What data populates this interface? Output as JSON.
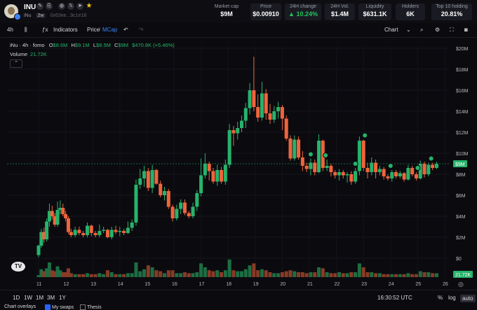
{
  "token": {
    "symbol": "INU",
    "name": "iNu",
    "timeframe_badge": "2w",
    "address": "0x63ee...9c1e18",
    "social_icons": [
      "globe-icon",
      "x-icon",
      "telegram-icon",
      "star-icon"
    ]
  },
  "stats": [
    {
      "label": "Market cap",
      "value": "$9M",
      "boxed": false
    },
    {
      "label": "Price",
      "value": "$0.00910",
      "boxed": true
    },
    {
      "label": "24H change",
      "value": "▲ 10.24%",
      "boxed": true,
      "color": "#22c55e"
    },
    {
      "label": "24H Vol.",
      "value": "$1.4M",
      "boxed": true
    },
    {
      "label": "Liquidity",
      "value": "$631.1K",
      "boxed": true
    },
    {
      "label": "Holders",
      "value": "6K",
      "boxed": true
    },
    {
      "label": "Top 10 holding",
      "value": "20.81%",
      "boxed": true
    }
  ],
  "toolbar": {
    "interval": "4h",
    "indicators": "Indicators",
    "price": "Price",
    "mcap": "MCap",
    "chart": "Chart"
  },
  "legend": {
    "title": "iNu · 4h · fomo",
    "o": "$8.6M",
    "h": "$9.1M",
    "l": "$8.5M",
    "c": "$9M",
    "change": "$470.8K (+5.46%)",
    "volume_label": "Volume",
    "volume_value": "21.72K"
  },
  "chart_data": {
    "type": "candlestick",
    "y_ticks": [
      "$0",
      "$2M",
      "$4M",
      "$6M",
      "$8M",
      "$10M",
      "$12M",
      "$14M",
      "$16M",
      "$18M",
      "$20M"
    ],
    "x_ticks": [
      "11",
      "12",
      "13",
      "14",
      "15",
      "16",
      "17",
      "18",
      "19",
      "20",
      "21",
      "22",
      "23",
      "24",
      "25",
      "26"
    ],
    "ylim": [
      0,
      20
    ],
    "current_price_label": "$9M",
    "volume_label": "21.72K",
    "candles": [
      [
        11.0,
        0.3,
        1.2,
        0.1,
        1.3,
        0.2
      ],
      [
        11.1,
        1.2,
        2.5,
        1.0,
        2.8,
        0.8
      ],
      [
        11.2,
        2.5,
        1.8,
        1.5,
        2.9,
        0.6
      ],
      [
        11.3,
        1.8,
        3.5,
        1.6,
        3.8,
        0.9
      ],
      [
        11.4,
        3.5,
        4.5,
        3.0,
        5.2,
        1.5
      ],
      [
        11.5,
        4.5,
        4.0,
        3.7,
        5.0,
        0.7
      ],
      [
        11.6,
        4.0,
        3.2,
        3.0,
        4.3,
        0.6
      ],
      [
        11.7,
        3.2,
        4.6,
        3.0,
        5.4,
        1.1
      ],
      [
        11.8,
        4.6,
        4.8,
        4.2,
        5.5,
        0.7
      ],
      [
        11.9,
        4.8,
        4.2,
        4.0,
        5.2,
        0.5
      ],
      [
        12.0,
        4.2,
        3.8,
        3.5,
        4.5,
        0.5
      ],
      [
        12.1,
        3.8,
        2.5,
        2.3,
        4.0,
        0.9
      ],
      [
        12.2,
        2.5,
        2.2,
        2.0,
        2.8,
        0.4
      ],
      [
        12.35,
        2.2,
        2.7,
        2.0,
        3.0,
        0.3
      ],
      [
        12.5,
        2.7,
        2.4,
        2.2,
        3.0,
        0.3
      ],
      [
        12.65,
        2.4,
        2.2,
        2.0,
        2.6,
        0.3
      ],
      [
        12.8,
        2.2,
        3.1,
        2.0,
        3.4,
        0.4
      ],
      [
        12.95,
        3.1,
        2.4,
        2.1,
        3.2,
        0.3
      ],
      [
        13.1,
        2.4,
        2.2,
        2.0,
        2.6,
        0.3
      ],
      [
        13.25,
        2.2,
        2.6,
        2.0,
        3.2,
        0.4
      ],
      [
        13.4,
        2.6,
        2.7,
        2.4,
        3.0,
        0.3
      ],
      [
        13.55,
        2.7,
        2.0,
        1.9,
        2.8,
        0.7
      ],
      [
        13.7,
        2.0,
        2.7,
        1.8,
        3.0,
        0.5
      ],
      [
        13.85,
        2.7,
        2.5,
        2.3,
        3.1,
        0.3
      ],
      [
        14.0,
        2.5,
        2.6,
        2.1,
        3.0,
        0.3
      ],
      [
        14.15,
        2.6,
        2.4,
        2.2,
        2.8,
        0.3
      ],
      [
        14.3,
        2.4,
        2.9,
        2.3,
        3.5,
        0.4
      ],
      [
        14.45,
        2.9,
        3.4,
        2.6,
        3.7,
        0.4
      ],
      [
        14.6,
        3.4,
        7.0,
        3.1,
        7.5,
        1.5
      ],
      [
        14.75,
        7.0,
        7.6,
        6.6,
        8.5,
        0.6
      ],
      [
        14.9,
        7.6,
        8.3,
        6.8,
        8.8,
        0.8
      ],
      [
        15.05,
        8.3,
        6.7,
        6.4,
        8.6,
        1.2
      ],
      [
        15.2,
        6.7,
        8.4,
        6.2,
        8.9,
        1.0
      ],
      [
        15.35,
        8.4,
        7.1,
        7.0,
        8.5,
        0.7
      ],
      [
        15.5,
        7.1,
        6.0,
        5.8,
        7.4,
        0.6
      ],
      [
        15.65,
        6.0,
        6.4,
        5.5,
        6.8,
        0.4
      ],
      [
        15.8,
        6.4,
        4.9,
        4.7,
        6.6,
        0.7
      ],
      [
        15.95,
        4.9,
        3.8,
        3.5,
        5.1,
        0.7
      ],
      [
        16.1,
        3.8,
        4.7,
        3.6,
        5.1,
        0.4
      ],
      [
        16.25,
        4.7,
        5.3,
        4.2,
        5.6,
        0.4
      ],
      [
        16.4,
        5.3,
        4.3,
        4.1,
        5.6,
        0.5
      ],
      [
        16.55,
        4.3,
        4.0,
        3.8,
        4.5,
        0.4
      ],
      [
        16.7,
        4.0,
        4.9,
        3.8,
        5.3,
        0.4
      ],
      [
        16.85,
        4.9,
        6.2,
        4.5,
        6.5,
        0.5
      ],
      [
        17.0,
        6.2,
        7.9,
        5.9,
        9.5,
        1.4
      ],
      [
        17.15,
        7.9,
        9.0,
        7.6,
        10.0,
        1.0
      ],
      [
        17.3,
        9.0,
        8.3,
        7.4,
        9.2,
        0.7
      ],
      [
        17.45,
        8.3,
        7.3,
        7.1,
        8.6,
        0.6
      ],
      [
        17.6,
        7.3,
        8.4,
        6.9,
        8.9,
        0.7
      ],
      [
        17.75,
        8.4,
        7.3,
        7.1,
        8.7,
        0.5
      ],
      [
        17.9,
        7.3,
        8.9,
        7.0,
        9.4,
        0.7
      ],
      [
        18.05,
        8.9,
        12.2,
        8.6,
        12.8,
        1.8
      ],
      [
        18.2,
        12.2,
        11.9,
        10.7,
        12.6,
        0.7
      ],
      [
        18.35,
        11.9,
        12.4,
        11.3,
        13.0,
        0.6
      ],
      [
        18.5,
        12.4,
        13.1,
        12.0,
        13.6,
        0.6
      ],
      [
        18.65,
        13.1,
        14.3,
        12.4,
        14.8,
        0.8
      ],
      [
        18.8,
        14.3,
        16.0,
        13.7,
        16.7,
        1.2
      ],
      [
        18.95,
        16.0,
        14.4,
        14.0,
        19.2,
        1.4
      ],
      [
        19.1,
        14.4,
        13.4,
        13.0,
        15.6,
        0.7
      ],
      [
        19.25,
        13.4,
        15.7,
        13.1,
        16.8,
        0.8
      ],
      [
        19.4,
        15.7,
        13.8,
        13.2,
        16.1,
        0.7
      ],
      [
        19.55,
        13.8,
        13.2,
        12.8,
        14.7,
        0.5
      ],
      [
        19.7,
        13.2,
        14.0,
        12.9,
        14.5,
        0.4
      ],
      [
        19.85,
        14.0,
        14.4,
        13.3,
        14.9,
        0.4
      ],
      [
        20.0,
        14.4,
        13.3,
        12.2,
        14.6,
        0.5
      ],
      [
        20.15,
        13.3,
        11.4,
        11.2,
        13.6,
        0.6
      ],
      [
        20.3,
        11.4,
        9.5,
        9.3,
        11.7,
        0.7
      ],
      [
        20.45,
        9.5,
        11.3,
        9.3,
        11.7,
        0.6
      ],
      [
        20.6,
        11.3,
        9.6,
        9.4,
        11.6,
        0.5
      ],
      [
        20.75,
        9.6,
        8.8,
        8.3,
        10.2,
        0.5
      ],
      [
        20.9,
        8.8,
        8.5,
        8.2,
        9.1,
        0.4
      ],
      [
        21.05,
        8.5,
        9.1,
        7.9,
        9.5,
        0.5
      ],
      [
        21.2,
        9.1,
        8.2,
        7.9,
        9.4,
        0.5
      ],
      [
        21.35,
        8.2,
        11.2,
        8.1,
        11.8,
        1.0
      ],
      [
        21.5,
        11.2,
        8.6,
        8.3,
        11.3,
        0.9
      ],
      [
        21.65,
        8.6,
        8.8,
        8.3,
        9.4,
        0.5
      ],
      [
        21.8,
        8.8,
        8.2,
        7.8,
        9.0,
        0.4
      ],
      [
        21.95,
        8.2,
        7.9,
        7.6,
        8.4,
        0.4
      ],
      [
        22.1,
        7.9,
        8.2,
        7.4,
        8.5,
        0.5
      ],
      [
        22.25,
        8.2,
        7.9,
        7.6,
        8.4,
        0.4
      ],
      [
        22.4,
        7.9,
        8.0,
        7.2,
        8.2,
        0.4
      ],
      [
        22.55,
        8.0,
        7.3,
        7.0,
        8.3,
        0.5
      ],
      [
        22.7,
        7.3,
        8.3,
        7.1,
        8.6,
        0.5
      ],
      [
        22.85,
        8.3,
        11.2,
        7.9,
        11.6,
        1.4
      ],
      [
        23.0,
        11.2,
        8.6,
        8.3,
        11.3,
        1.0
      ],
      [
        23.15,
        8.6,
        8.2,
        7.6,
        9.1,
        0.5
      ],
      [
        23.3,
        8.2,
        9.1,
        7.9,
        9.6,
        0.5
      ],
      [
        23.45,
        9.1,
        8.2,
        7.6,
        9.4,
        0.4
      ],
      [
        23.6,
        8.2,
        8.5,
        7.9,
        8.8,
        0.4
      ],
      [
        23.75,
        8.5,
        7.8,
        7.5,
        8.7,
        0.3
      ],
      [
        23.9,
        7.8,
        7.6,
        7.4,
        8.0,
        0.3
      ],
      [
        24.05,
        7.6,
        8.2,
        7.3,
        8.4,
        0.3
      ],
      [
        24.2,
        8.2,
        7.8,
        7.6,
        8.4,
        0.3
      ],
      [
        24.35,
        7.8,
        8.1,
        7.6,
        8.3,
        0.3
      ],
      [
        24.5,
        8.1,
        7.5,
        7.3,
        8.2,
        0.3
      ],
      [
        24.65,
        7.5,
        8.6,
        7.4,
        8.9,
        0.4
      ],
      [
        24.8,
        8.6,
        8.0,
        7.8,
        8.8,
        0.3
      ],
      [
        24.95,
        8.0,
        7.6,
        7.4,
        8.2,
        0.3
      ],
      [
        25.1,
        7.6,
        9.0,
        7.5,
        9.3,
        0.6
      ],
      [
        25.25,
        9.0,
        8.0,
        7.7,
        9.2,
        0.5
      ],
      [
        25.4,
        8.0,
        8.9,
        7.8,
        9.1,
        0.5
      ],
      [
        25.55,
        8.9,
        8.6,
        8.4,
        9.1,
        0.4
      ],
      [
        25.7,
        8.6,
        9.0,
        8.5,
        9.2,
        0.4
      ]
    ],
    "markers": [
      21.05,
      21.6,
      22.7,
      23.05,
      24.0,
      25.0,
      25.5
    ]
  },
  "range_buttons": [
    "1D",
    "1W",
    "1M",
    "3M",
    "1Y"
  ],
  "bottom": {
    "time": "16:30:52 UTC",
    "percent": "%",
    "log": "log",
    "auto": "auto"
  },
  "overlays": {
    "title": "Chart overlays",
    "my_swaps": "My swaps",
    "thesis": "Thesis"
  }
}
